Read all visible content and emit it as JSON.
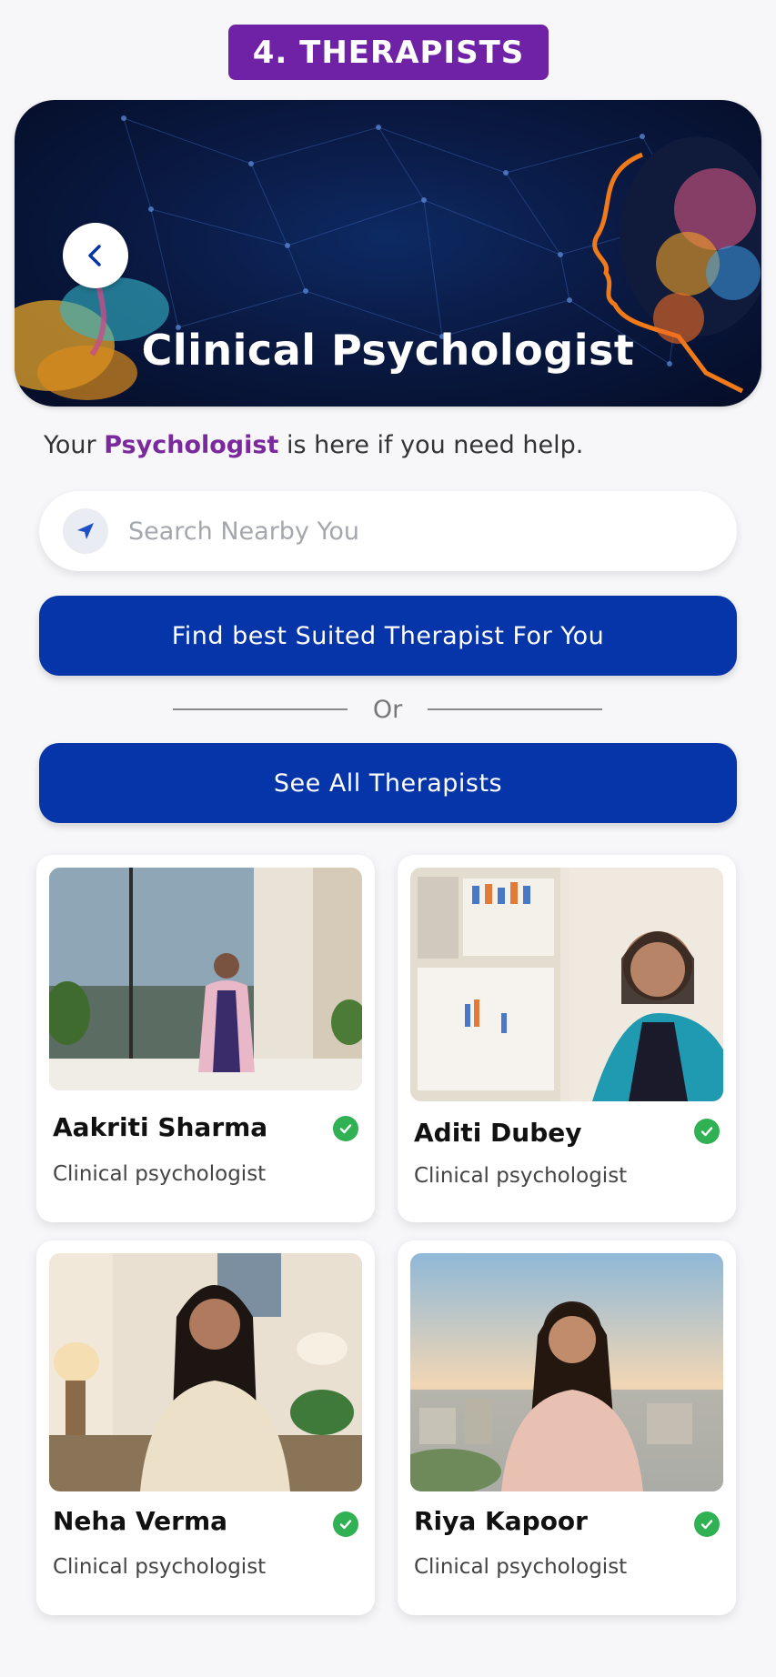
{
  "header": {
    "badge": "4. THERAPISTS"
  },
  "hero": {
    "title": "Clinical Psychologist",
    "back_icon": "chevron-left-icon"
  },
  "tagline": {
    "prefix": "Your ",
    "highlight": "Psychologist",
    "suffix": " is here if you need help."
  },
  "search": {
    "placeholder": "Search Nearby You",
    "icon": "location-arrow-icon"
  },
  "actions": {
    "find_label": "Find best Suited Therapist For You",
    "or_label": "Or",
    "see_all_label": "See All Therapists"
  },
  "therapists": [
    {
      "name": "Aakriti Sharma",
      "role": "Clinical psychologist",
      "verified": true
    },
    {
      "name": "Aditi Dubey",
      "role": "Clinical psychologist",
      "verified": true
    },
    {
      "name": "Neha Verma",
      "role": "Clinical psychologist",
      "verified": true
    },
    {
      "name": "Riya Kapoor",
      "role": "Clinical psychologist",
      "verified": true
    }
  ],
  "colors": {
    "badge": "#6f22a6",
    "primary_button": "#0535a8",
    "highlight_text": "#7b2a9e",
    "verified": "#2fb154"
  }
}
